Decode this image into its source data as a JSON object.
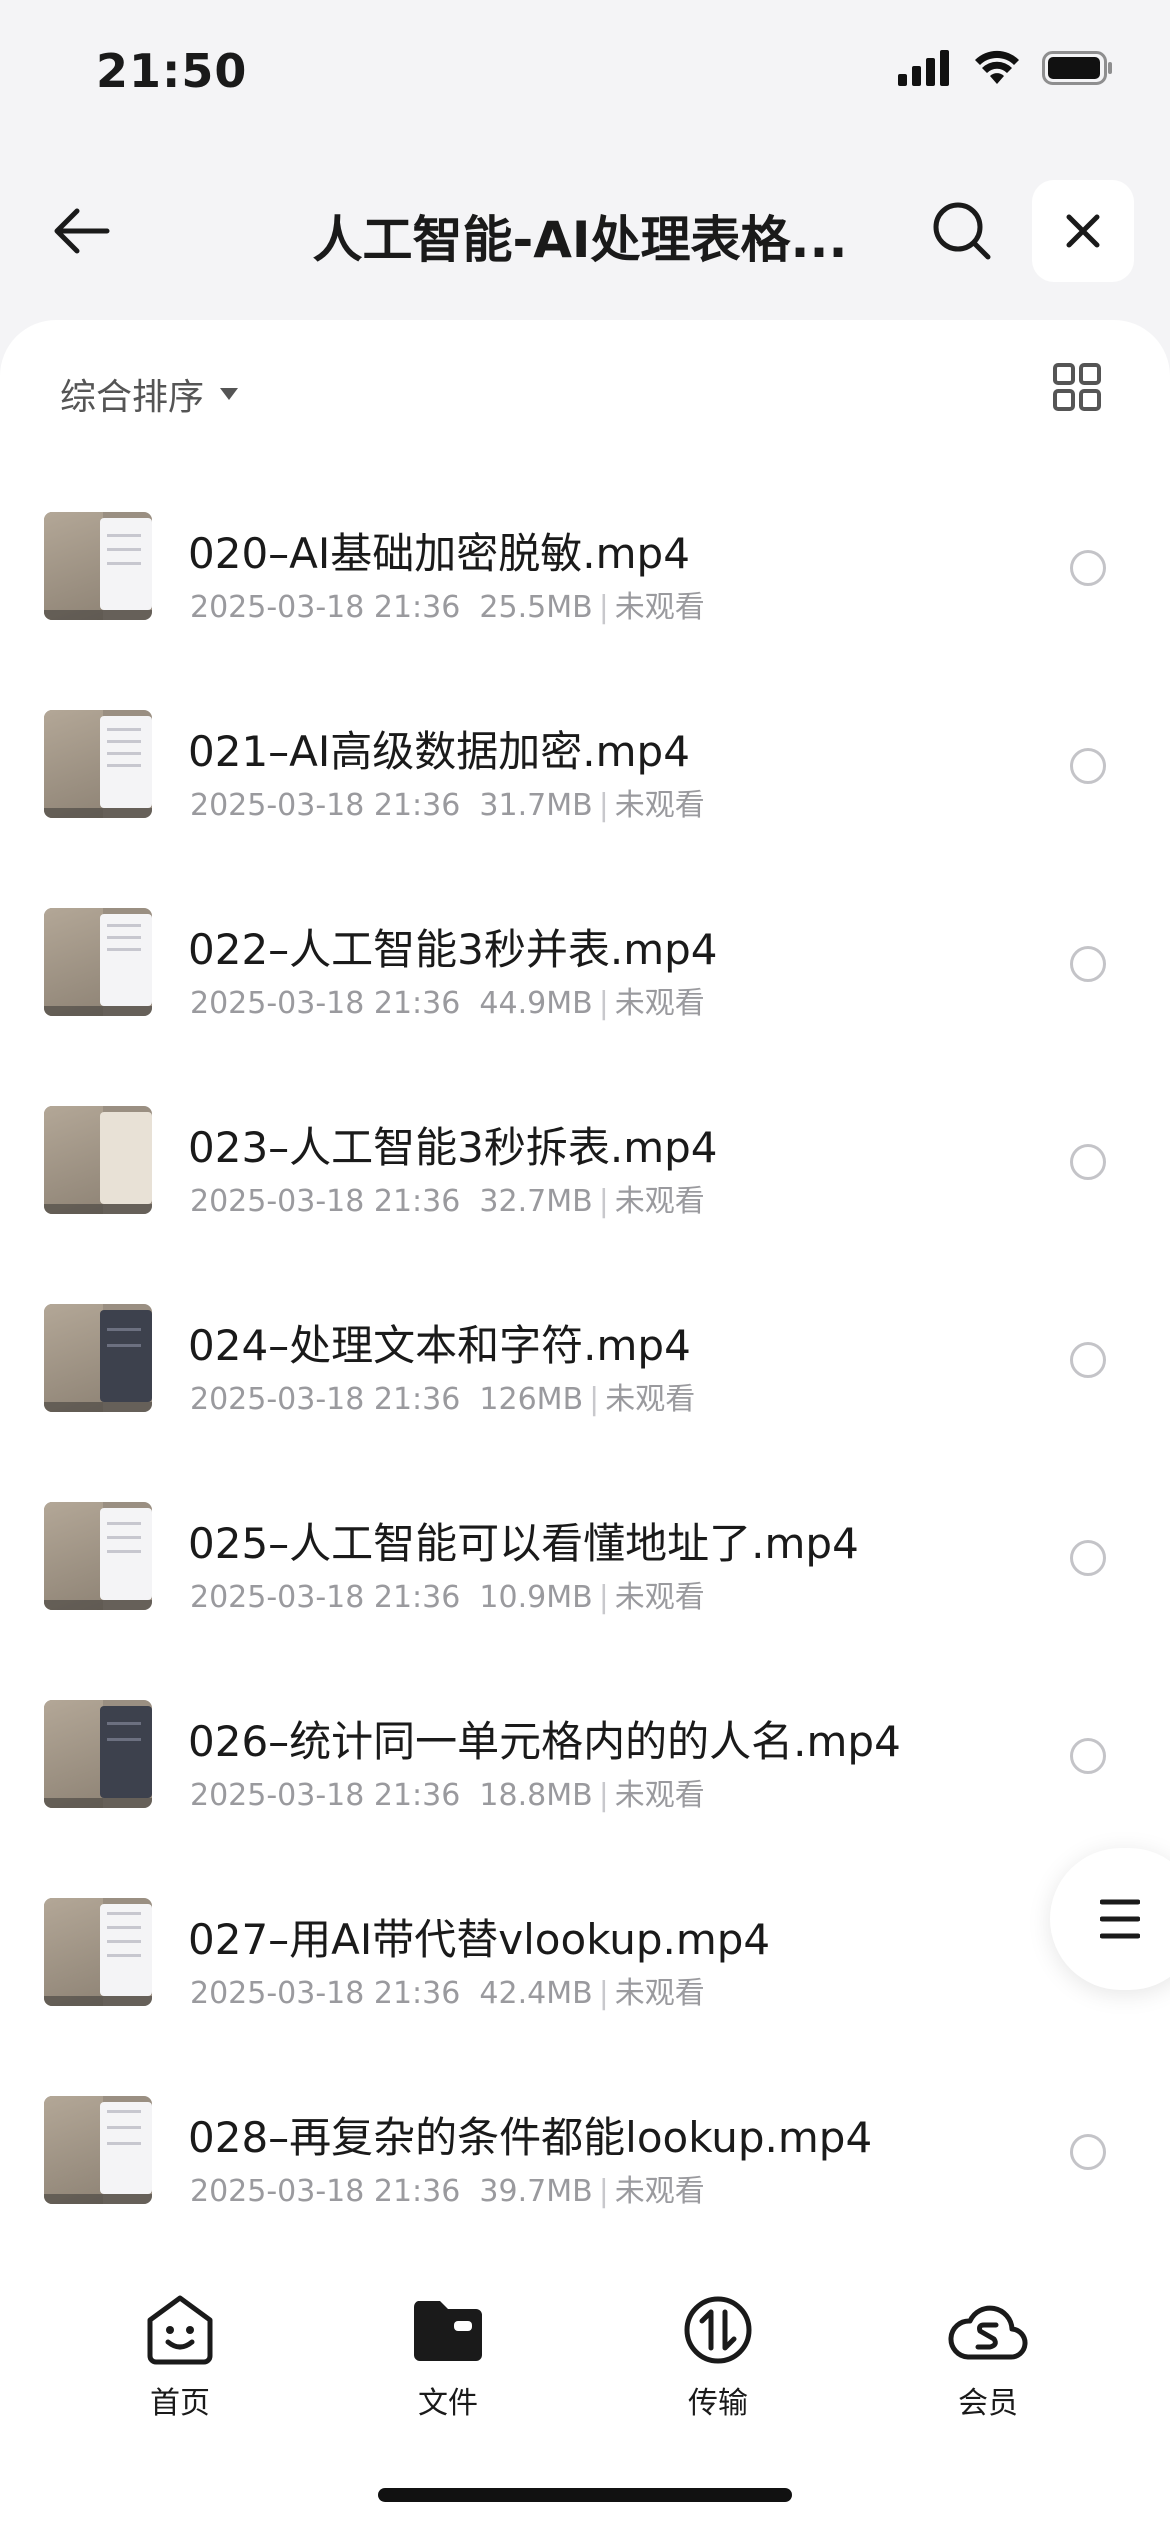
{
  "status_bar": {
    "time": "21:50"
  },
  "header": {
    "title": "人工智能-AI处理表格..."
  },
  "sort": {
    "label": "综合排序"
  },
  "files": [
    {
      "name": "020–AI基础加密脱敏.mp4",
      "date": "2025-03-18 21:36",
      "size": "25.5MB",
      "status": "未观看"
    },
    {
      "name": "021–AI高级数据加密.mp4",
      "date": "2025-03-18 21:36",
      "size": "31.7MB",
      "status": "未观看"
    },
    {
      "name": "022–人工智能3秒并表.mp4",
      "date": "2025-03-18 21:36",
      "size": "44.9MB",
      "status": "未观看"
    },
    {
      "name": "023–人工智能3秒拆表.mp4",
      "date": "2025-03-18 21:36",
      "size": "32.7MB",
      "status": "未观看"
    },
    {
      "name": "024–处理文本和字符.mp4",
      "date": "2025-03-18 21:36",
      "size": "126MB",
      "status": "未观看"
    },
    {
      "name": "025–人工智能可以看懂地址了.mp4",
      "date": "2025-03-18 21:36",
      "size": "10.9MB",
      "status": "未观看"
    },
    {
      "name": "026–统计同一单元格内的的人名.mp4",
      "date": "2025-03-18 21:36",
      "size": "18.8MB",
      "status": "未观看"
    },
    {
      "name": "027–用AI带代替vlookup.mp4",
      "date": "2025-03-18 21:36",
      "size": "42.4MB",
      "status": "未观看"
    },
    {
      "name": "028–再复杂的条件都能lookup.mp4",
      "date": "2025-03-18 21:36",
      "size": "39.7MB",
      "status": "未观看"
    }
  ],
  "tabs": [
    {
      "label": "首页",
      "icon": "smile-face-icon"
    },
    {
      "label": "文件",
      "icon": "folder-icon"
    },
    {
      "label": "传输",
      "icon": "transfer-icon"
    },
    {
      "label": "会员",
      "icon": "cloud-icon"
    }
  ],
  "colors": {
    "accent": "#1a1a1a",
    "meta": "#9a9a9e",
    "background": "#f4f4f6"
  }
}
